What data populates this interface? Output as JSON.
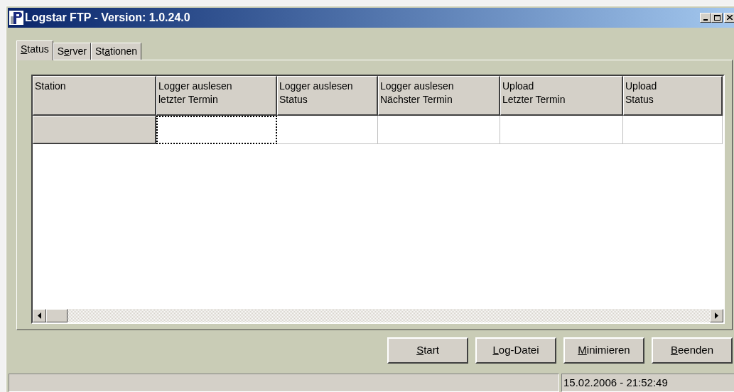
{
  "window": {
    "title": "Logstar FTP - Version: 1.0.24.0"
  },
  "tabs": [
    {
      "label": [
        {
          "text": "S",
          "underline": true
        },
        {
          "text": "tatus",
          "underline": false
        }
      ],
      "selected": true
    },
    {
      "label": [
        {
          "text": "S",
          "underline": false
        },
        {
          "text": "e",
          "underline": true
        },
        {
          "text": "rver",
          "underline": false
        }
      ],
      "selected": false
    },
    {
      "label": [
        {
          "text": "St",
          "underline": false
        },
        {
          "text": "a",
          "underline": true
        },
        {
          "text": "tionen",
          "underline": false
        }
      ],
      "selected": false
    }
  ],
  "table": {
    "columns": [
      "Station",
      "Logger auslesen\nletzter Termin",
      "Logger auslesen\nStatus",
      "Logger auslesen\nNächster Termin",
      "Upload\nLetzter Termin",
      "Upload\nStatus"
    ],
    "rows": [
      {
        "cells": [
          {
            "focused": true
          },
          {
            "focused": false
          },
          {
            "focused": false
          },
          {
            "focused": false
          },
          {
            "focused": false
          }
        ]
      }
    ]
  },
  "buttons": [
    {
      "label": [
        {
          "text": "S",
          "underline": true
        },
        {
          "text": "tart",
          "underline": false
        }
      ]
    },
    {
      "label": [
        {
          "text": "L",
          "underline": true
        },
        {
          "text": "og-Datei",
          "underline": false
        }
      ]
    },
    {
      "label": [
        {
          "text": "M",
          "underline": true
        },
        {
          "text": "inimieren",
          "underline": false
        }
      ]
    },
    {
      "label": [
        {
          "text": "B",
          "underline": true
        },
        {
          "text": "eenden",
          "underline": false
        }
      ]
    }
  ],
  "status_bar": {
    "datetime": "15.02.2006 - 21:52:49"
  }
}
